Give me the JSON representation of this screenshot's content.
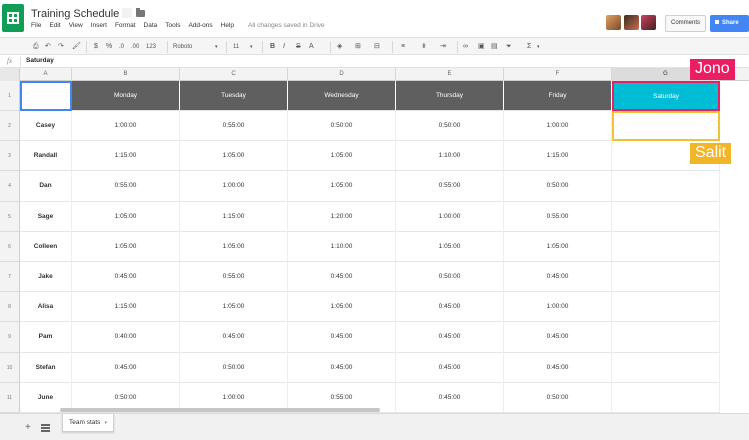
{
  "app": {
    "title": "Training Schedule",
    "menu": [
      "File",
      "Edit",
      "View",
      "Insert",
      "Format",
      "Data",
      "Tools",
      "Add-ons",
      "Help"
    ],
    "save_status": "All changes saved in Drive",
    "comments_label": "Comments",
    "share_label": "Share"
  },
  "toolbar": {
    "currency_label": "$",
    "percent_label": "%",
    "decimal_dec_label": ".0",
    "decimal_inc_label": ".00",
    "more_formats_label": "123",
    "font": "Roboto",
    "font_size": "11",
    "bold_label": "B",
    "italic_label": "I",
    "strike_label": "S",
    "text_color_label": "A",
    "function_label": "Σ"
  },
  "formula_bar": {
    "fx_label": "fx",
    "content": "Saturday"
  },
  "columns": [
    "A",
    "B",
    "C",
    "D",
    "E",
    "F",
    "G"
  ],
  "rows": [
    "1",
    "2",
    "3",
    "4",
    "5",
    "6",
    "7",
    "8",
    "9",
    "10",
    "11"
  ],
  "sheet": {
    "header": [
      "",
      "Monday",
      "Tuesday",
      "Wednesday",
      "Thursday",
      "Friday",
      "Saturday"
    ],
    "data": [
      [
        "Casey",
        "1:00:00",
        "0:55:00",
        "0:50:00",
        "0:50:00",
        "1:00:00",
        ""
      ],
      [
        "Randall",
        "1:15:00",
        "1:05:00",
        "1:05:00",
        "1:10:00",
        "1:15:00",
        ""
      ],
      [
        "Dan",
        "0:55:00",
        "1:00:00",
        "1:05:00",
        "0:55:00",
        "0:50:00",
        ""
      ],
      [
        "Sage",
        "1:05:00",
        "1:15:00",
        "1:20:00",
        "1:00:00",
        "0:55:00",
        ""
      ],
      [
        "Colleen",
        "1:05:00",
        "1:05:00",
        "1:10:00",
        "1:05:00",
        "1:05:00",
        ""
      ],
      [
        "Jake",
        "0:45:00",
        "0:55:00",
        "0:45:00",
        "0:50:00",
        "0:45:00",
        ""
      ],
      [
        "Alisa",
        "1:15:00",
        "1:05:00",
        "1:05:00",
        "0:45:00",
        "1:00:00",
        ""
      ],
      [
        "Pam",
        "0:40:00",
        "0:45:00",
        "0:45:00",
        "0:45:00",
        "0:45:00",
        ""
      ],
      [
        "Stefan",
        "0:45:00",
        "0:50:00",
        "0:45:00",
        "0:45:00",
        "0:45:00",
        ""
      ],
      [
        "June",
        "0:50:00",
        "1:00:00",
        "0:55:00",
        "0:45:00",
        "0:50:00",
        ""
      ]
    ]
  },
  "collaborators": {
    "jono": "Jono",
    "salit": "Salit"
  },
  "sheet_tab": "Team stats",
  "colors": {
    "header_bg": "#5f5f5f",
    "saturday_bg": "#00bcd4",
    "jono": "#e91e63",
    "salit": "#f2b527",
    "share": "#4285f4",
    "app": "#0f9d58"
  },
  "icons": [
    "sheets-logo-icon",
    "star-icon",
    "folder-icon",
    "print-icon",
    "undo-icon",
    "redo-icon",
    "paint-format-icon",
    "fill-color-icon",
    "borders-icon",
    "merge-icon",
    "align-icon",
    "valign-icon",
    "wrap-icon",
    "link-icon",
    "comment-icon",
    "chart-icon",
    "filter-icon",
    "add-sheet-icon",
    "sheets-list-icon"
  ]
}
